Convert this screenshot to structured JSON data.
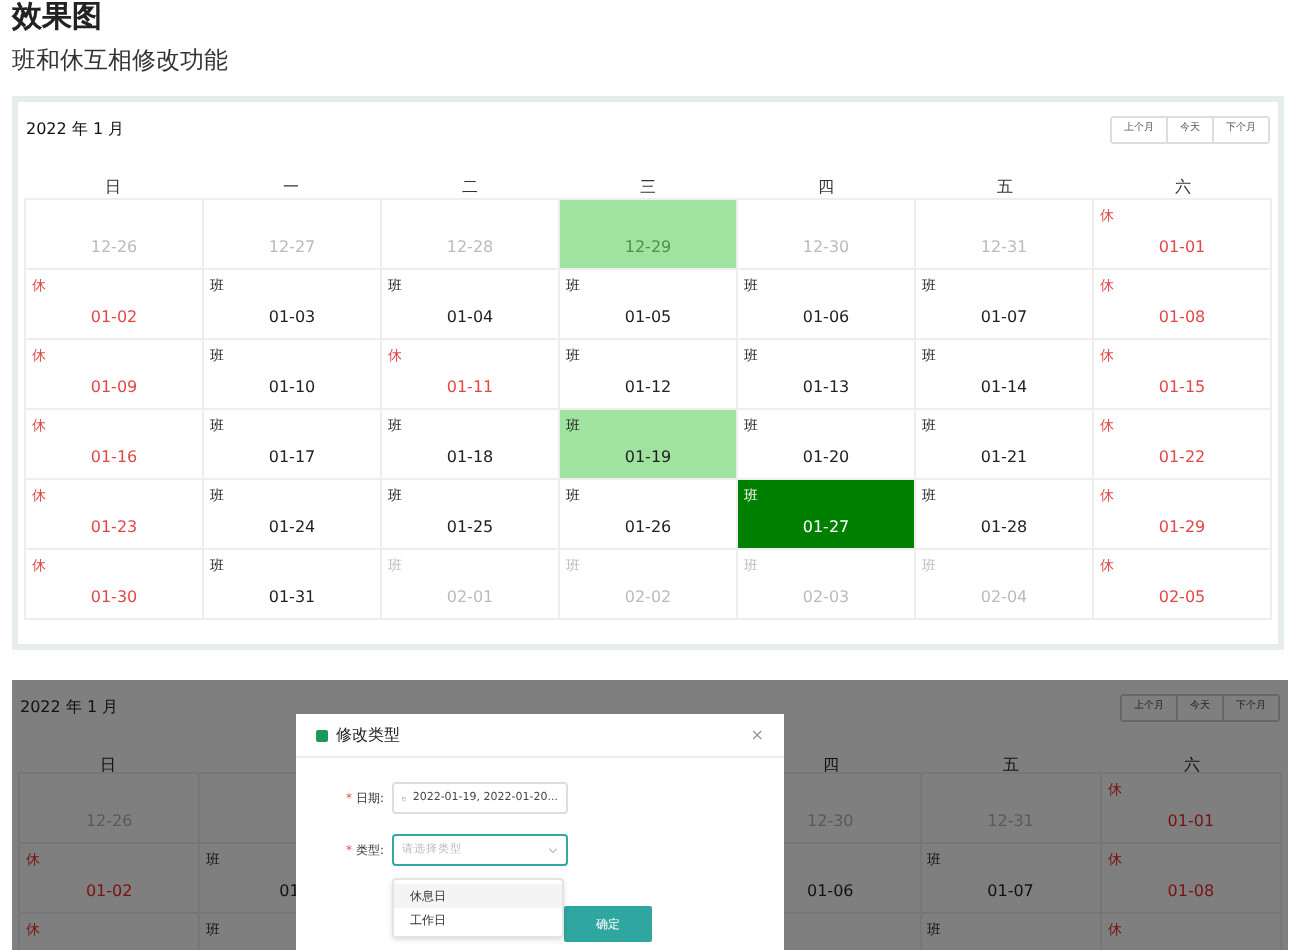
{
  "heading": "效果图",
  "subtitle": "班和休互相修改功能",
  "calendar": {
    "title": "2022 年 1 月",
    "nav": [
      "上个月",
      "今天",
      "下个月"
    ],
    "weekdays": [
      "日",
      "一",
      "二",
      "三",
      "四",
      "五",
      "六"
    ],
    "rows": [
      [
        {
          "kind": "muted",
          "date": "12-26",
          "selected": false,
          "today": false
        },
        {
          "kind": "muted",
          "date": "12-27",
          "selected": false,
          "today": false
        },
        {
          "kind": "muted",
          "date": "12-28",
          "selected": false,
          "today": false
        },
        {
          "kind": "muted",
          "date": "12-29",
          "selected": true,
          "today": false
        },
        {
          "kind": "muted",
          "date": "12-30",
          "selected": false,
          "today": false
        },
        {
          "kind": "muted",
          "date": "12-31",
          "selected": false,
          "today": false
        },
        {
          "kind": "rest",
          "tag": "休",
          "date": "01-01",
          "selected": false,
          "today": false
        }
      ],
      [
        {
          "kind": "rest",
          "tag": "休",
          "date": "01-02",
          "selected": false,
          "today": false
        },
        {
          "kind": "work",
          "tag": "班",
          "date": "01-03",
          "selected": false,
          "today": false
        },
        {
          "kind": "work",
          "tag": "班",
          "date": "01-04",
          "selected": false,
          "today": false
        },
        {
          "kind": "work",
          "tag": "班",
          "date": "01-05",
          "selected": false,
          "today": false
        },
        {
          "kind": "work",
          "tag": "班",
          "date": "01-06",
          "selected": false,
          "today": false
        },
        {
          "kind": "work",
          "tag": "班",
          "date": "01-07",
          "selected": false,
          "today": false
        },
        {
          "kind": "rest",
          "tag": "休",
          "date": "01-08",
          "selected": false,
          "today": false
        }
      ],
      [
        {
          "kind": "rest",
          "tag": "休",
          "date": "01-09",
          "selected": false,
          "today": false
        },
        {
          "kind": "work",
          "tag": "班",
          "date": "01-10",
          "selected": false,
          "today": false
        },
        {
          "kind": "rest",
          "tag": "休",
          "date": "01-11",
          "selected": false,
          "today": false
        },
        {
          "kind": "work",
          "tag": "班",
          "date": "01-12",
          "selected": false,
          "today": false
        },
        {
          "kind": "work",
          "tag": "班",
          "date": "01-13",
          "selected": false,
          "today": false
        },
        {
          "kind": "work",
          "tag": "班",
          "date": "01-14",
          "selected": false,
          "today": false
        },
        {
          "kind": "rest",
          "tag": "休",
          "date": "01-15",
          "selected": false,
          "today": false
        }
      ],
      [
        {
          "kind": "rest",
          "tag": "休",
          "date": "01-16",
          "selected": false,
          "today": false
        },
        {
          "kind": "work",
          "tag": "班",
          "date": "01-17",
          "selected": false,
          "today": false
        },
        {
          "kind": "work",
          "tag": "班",
          "date": "01-18",
          "selected": false,
          "today": false
        },
        {
          "kind": "work",
          "tag": "班",
          "date": "01-19",
          "selected": true,
          "today": false
        },
        {
          "kind": "work",
          "tag": "班",
          "date": "01-20",
          "selected": false,
          "today": false
        },
        {
          "kind": "work",
          "tag": "班",
          "date": "01-21",
          "selected": false,
          "today": false
        },
        {
          "kind": "rest",
          "tag": "休",
          "date": "01-22",
          "selected": false,
          "today": false
        }
      ],
      [
        {
          "kind": "rest",
          "tag": "休",
          "date": "01-23",
          "selected": false,
          "today": false
        },
        {
          "kind": "work",
          "tag": "班",
          "date": "01-24",
          "selected": false,
          "today": false
        },
        {
          "kind": "work",
          "tag": "班",
          "date": "01-25",
          "selected": false,
          "today": false
        },
        {
          "kind": "work",
          "tag": "班",
          "date": "01-26",
          "selected": false,
          "today": false
        },
        {
          "kind": "work",
          "tag": "班",
          "date": "01-27",
          "selected": false,
          "today": true
        },
        {
          "kind": "work",
          "tag": "班",
          "date": "01-28",
          "selected": false,
          "today": false
        },
        {
          "kind": "rest",
          "tag": "休",
          "date": "01-29",
          "selected": false,
          "today": false
        }
      ],
      [
        {
          "kind": "rest",
          "tag": "休",
          "date": "01-30",
          "selected": false,
          "today": false
        },
        {
          "kind": "work",
          "tag": "班",
          "date": "01-31",
          "selected": false,
          "today": false
        },
        {
          "kind": "muted",
          "tag": "班",
          "date": "02-01",
          "selected": false,
          "today": false
        },
        {
          "kind": "muted",
          "tag": "班",
          "date": "02-02",
          "selected": false,
          "today": false
        },
        {
          "kind": "muted",
          "tag": "班",
          "date": "02-03",
          "selected": false,
          "today": false
        },
        {
          "kind": "muted",
          "tag": "班",
          "date": "02-04",
          "selected": false,
          "today": false
        },
        {
          "kind": "rest",
          "tag": "休",
          "date": "02-05",
          "selected": false,
          "today": false
        }
      ]
    ]
  },
  "dimmed_calendar": {
    "title": "2022 年 1 月",
    "nav": [
      "上个月",
      "今天",
      "下个月"
    ],
    "weekdays_left": [
      "日"
    ],
    "weekdays_right": [
      "四",
      "五",
      "六"
    ],
    "rows": [
      {
        "left": [
          {
            "kind": "muted",
            "date": "12-26"
          }
        ],
        "right": [
          {
            "kind": "muted",
            "date": "12-30"
          },
          {
            "kind": "muted",
            "date": "12-31"
          },
          {
            "kind": "rest",
            "tag": "休",
            "date": "01-01"
          }
        ]
      },
      {
        "left": [
          {
            "kind": "rest",
            "tag": "休",
            "date": "01-02"
          },
          {
            "kind": "work",
            "tag": "班",
            "date": "01"
          }
        ],
        "right": [
          {
            "kind": "work",
            "date": "01-06"
          },
          {
            "kind": "work",
            "tag": "班",
            "date": "01-07"
          },
          {
            "kind": "rest",
            "tag": "休",
            "date": "01-08"
          }
        ]
      },
      {
        "left": [
          {
            "kind": "rest",
            "tag": "休"
          },
          {
            "kind": "work",
            "tag": "班"
          }
        ],
        "right": [
          {
            "kind": "work",
            "tag": "班"
          },
          {
            "kind": "rest",
            "tag": "休"
          }
        ]
      }
    ]
  },
  "dialog": {
    "title": "修改类型",
    "close": "×",
    "fields": [
      {
        "kind": "date",
        "mark": "*",
        "label": "日期:",
        "value": "2022-01-19, 2022-01-20...",
        "focused": false
      },
      {
        "kind": "select",
        "mark": "*",
        "label": "类型:",
        "placeholder": "请选择类型",
        "focused": true
      }
    ],
    "options": [
      {
        "label": "休息日",
        "selected": true
      },
      {
        "label": "工作日",
        "selected": false
      }
    ],
    "confirm": "确定"
  }
}
